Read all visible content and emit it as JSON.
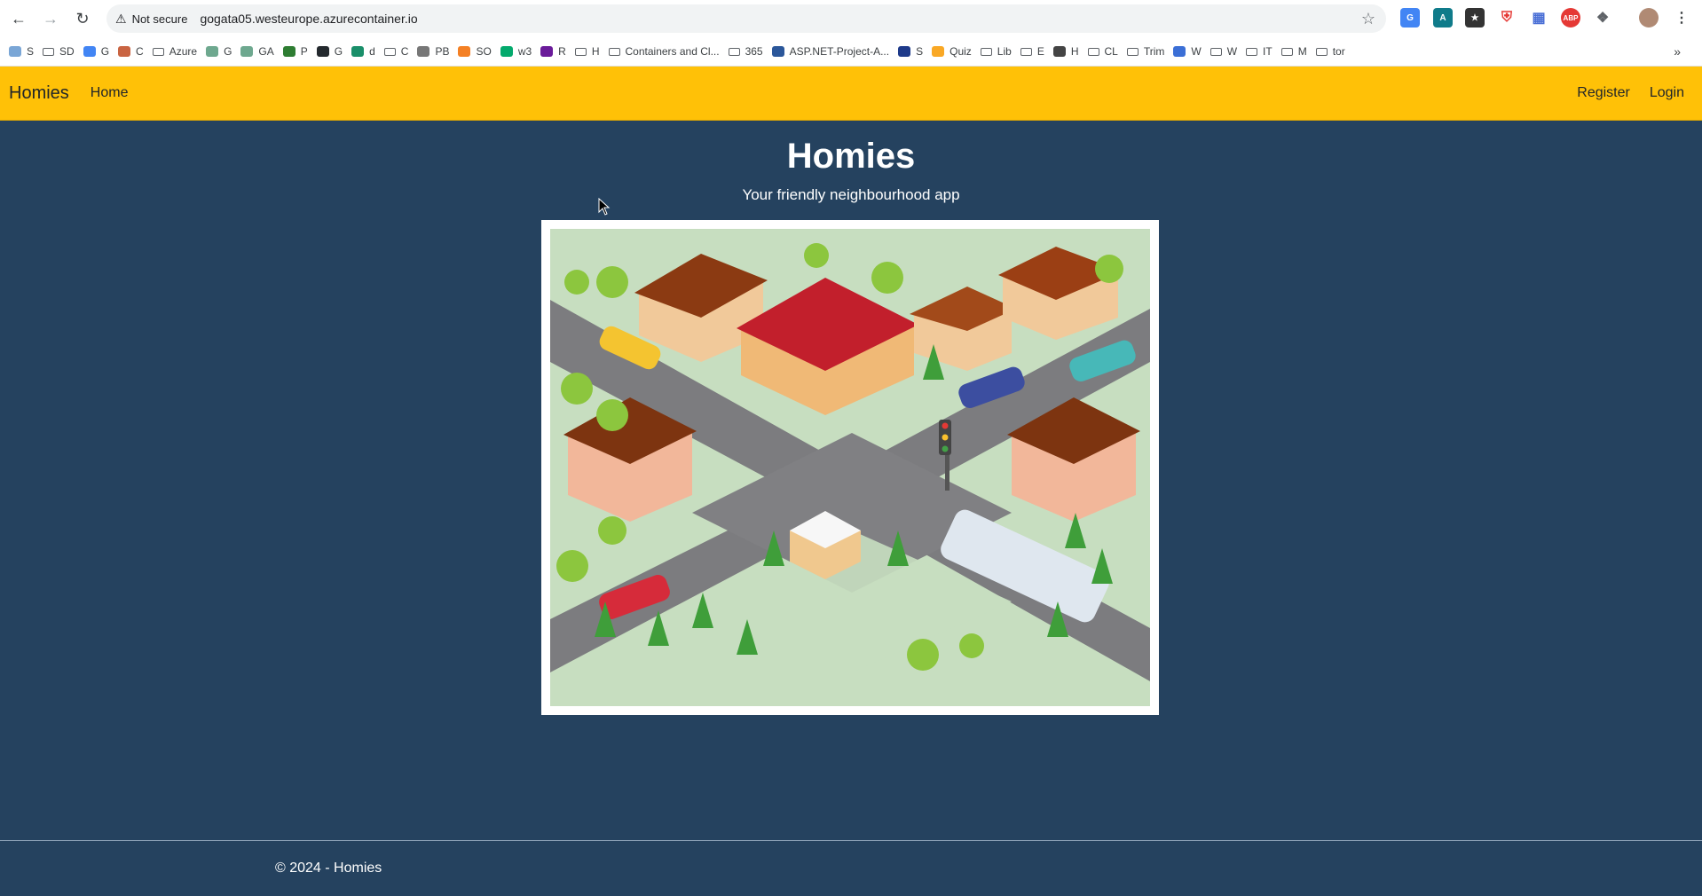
{
  "browser": {
    "security_label": "Not secure",
    "url": "gogata05.westeurope.azurecontainer.io",
    "bookmarks": [
      {
        "label": "S",
        "icon": "doc-icon"
      },
      {
        "label": "SD",
        "icon": "folder-icon"
      },
      {
        "label": "G",
        "icon": "gemini-icon"
      },
      {
        "label": "C",
        "icon": "anthropic-icon"
      },
      {
        "label": "Azure",
        "icon": "folder-icon"
      },
      {
        "label": "G",
        "icon": "chatgpt-icon"
      },
      {
        "label": "GA",
        "icon": "chatgpt-icon"
      },
      {
        "label": "P",
        "icon": "pi-icon"
      },
      {
        "label": "G",
        "icon": "github-icon"
      },
      {
        "label": "d",
        "icon": "d-icon"
      },
      {
        "label": "C",
        "icon": "folder-icon"
      },
      {
        "label": "PB",
        "icon": "grid-icon"
      },
      {
        "label": "SO",
        "icon": "stackoverflow-icon"
      },
      {
        "label": "w3",
        "icon": "w3-icon"
      },
      {
        "label": "R",
        "icon": "info-icon"
      },
      {
        "label": "H",
        "icon": "folder-icon"
      },
      {
        "label": "Containers and Cl...",
        "icon": "folder-icon"
      },
      {
        "label": "365",
        "icon": "folder-icon"
      },
      {
        "label": "ASP.NET-Project-A...",
        "icon": "word-icon"
      },
      {
        "label": "S",
        "icon": "app-icon"
      },
      {
        "label": "Quiz",
        "icon": "quiz-icon"
      },
      {
        "label": "Lib",
        "icon": "folder-icon"
      },
      {
        "label": "E",
        "icon": "folder-icon"
      },
      {
        "label": "H",
        "icon": "globe-icon"
      },
      {
        "label": "CL",
        "icon": "folder-icon"
      },
      {
        "label": "Trim",
        "icon": "folder-icon"
      },
      {
        "label": "W",
        "icon": "hex-icon"
      },
      {
        "label": "W",
        "icon": "folder-icon"
      },
      {
        "label": "IT",
        "icon": "folder-icon"
      },
      {
        "label": "M",
        "icon": "folder-icon"
      },
      {
        "label": "tor",
        "icon": "folder-icon"
      }
    ]
  },
  "nav": {
    "brand": "Homies",
    "home": "Home",
    "register": "Register",
    "login": "Login"
  },
  "hero": {
    "title": "Homies",
    "subtitle": "Your friendly neighbourhood app"
  },
  "footer": {
    "copyright": "© 2024 - Homies"
  },
  "colors": {
    "navbar": "#ffc107",
    "background": "#25425f"
  }
}
